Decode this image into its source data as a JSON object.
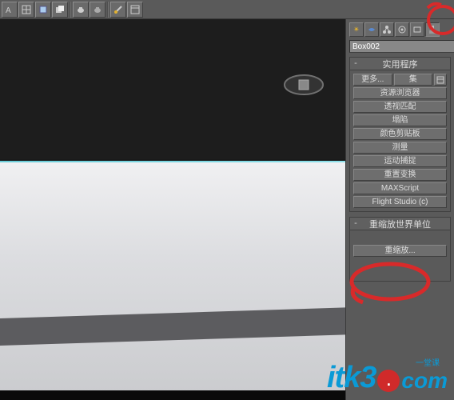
{
  "toolbar_icons": [
    "text-icon",
    "grid-icon",
    "select-icon",
    "stack-icon",
    "teapot-icon",
    "teapot-icon",
    "brush-icon",
    "window-icon"
  ],
  "tabs": {
    "create": "✴",
    "modify": "◐",
    "hierarchy": "♜",
    "motion": "◎",
    "display": "▣",
    "utilities": "🔨"
  },
  "object_name": "Box002",
  "rollout_utilities": {
    "title": "实用程序",
    "more": "更多...",
    "sets": "集",
    "items": [
      "资源浏览器",
      "透视匹配",
      "塌陷",
      "颜色剪贴板",
      "测量",
      "运动捕捉",
      "重置变换",
      "MAXScript",
      "Flight Studio (c)"
    ]
  },
  "rollout_rescale": {
    "title": "重缩放世界单位",
    "button": "重缩放..."
  },
  "watermark": {
    "itk": "itk3",
    "dot": ".",
    "com": "com",
    "tag": "一堂课"
  }
}
